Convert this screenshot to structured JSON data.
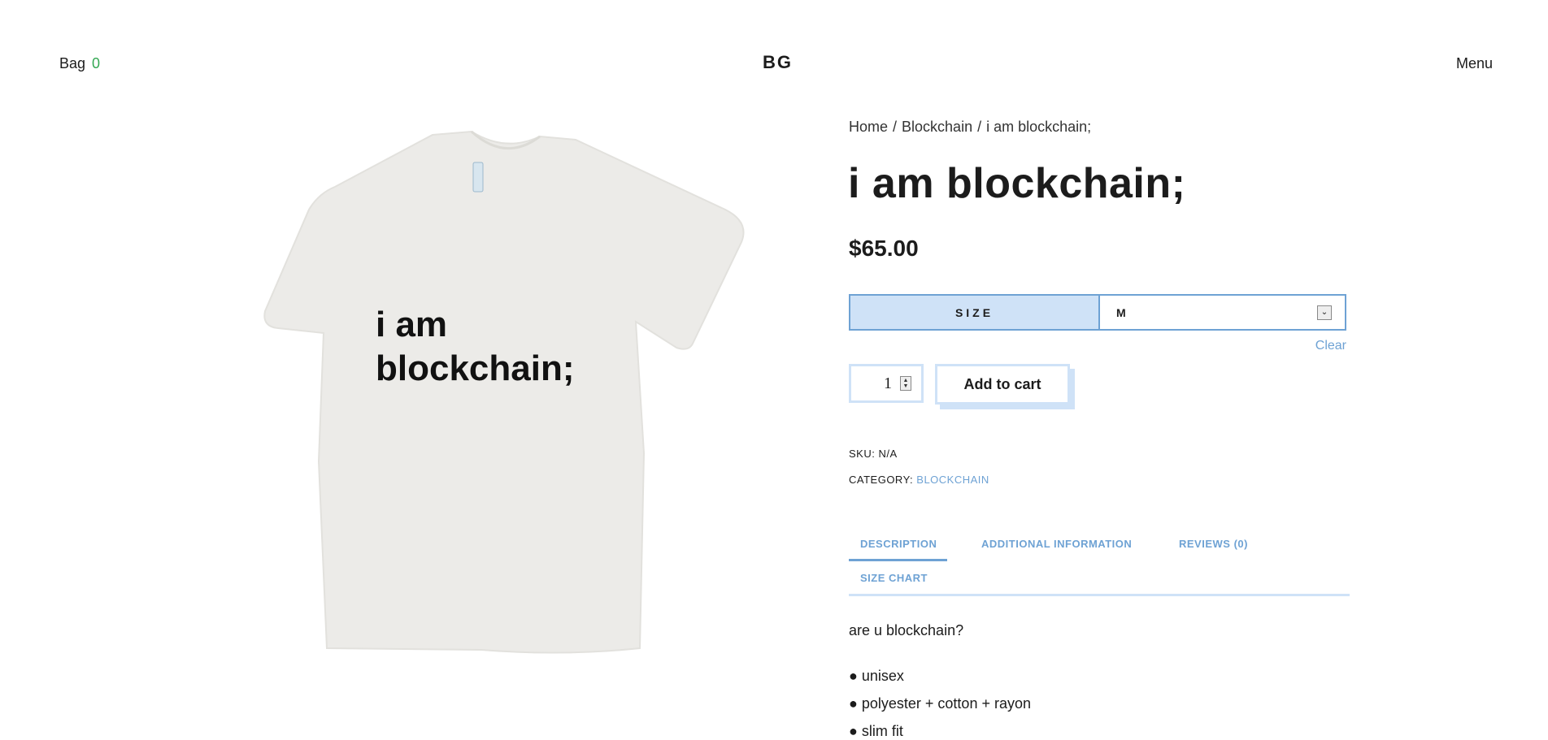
{
  "header": {
    "bag_label": "Bag",
    "bag_count": "0",
    "logo": "BG",
    "menu_label": "Menu"
  },
  "product_image": {
    "shirt_text_line1": "i am",
    "shirt_text_line2": "blockchain;"
  },
  "breadcrumb": {
    "home": "Home",
    "category": "Blockchain",
    "current": "i am blockchain;",
    "separator": "/"
  },
  "product": {
    "title": "i am blockchain;",
    "price": "$65.00"
  },
  "variation": {
    "label": "SIZE",
    "selected": "M",
    "clear_label": "Clear"
  },
  "cart": {
    "quantity": "1",
    "add_label": "Add to cart"
  },
  "meta": {
    "sku_label": "SKU:",
    "sku_value": "N/A",
    "category_label": "CATEGORY:",
    "category_value": "BLOCKCHAIN"
  },
  "tabs": [
    {
      "label": "DESCRIPTION",
      "active": true
    },
    {
      "label": "ADDITIONAL INFORMATION",
      "active": false
    },
    {
      "label": "REVIEWS (0)",
      "active": false
    },
    {
      "label": "SIZE CHART",
      "active": false
    }
  ],
  "description": {
    "intro": "are u blockchain?",
    "bullets": [
      "● unisex",
      "● polyester + cotton + rayon",
      "● slim fit"
    ]
  },
  "colors": {
    "accent": "#6ea2d4",
    "accent_light": "#cfe2f7",
    "bag_count": "#34a853",
    "shirt": "#ecebe8"
  }
}
